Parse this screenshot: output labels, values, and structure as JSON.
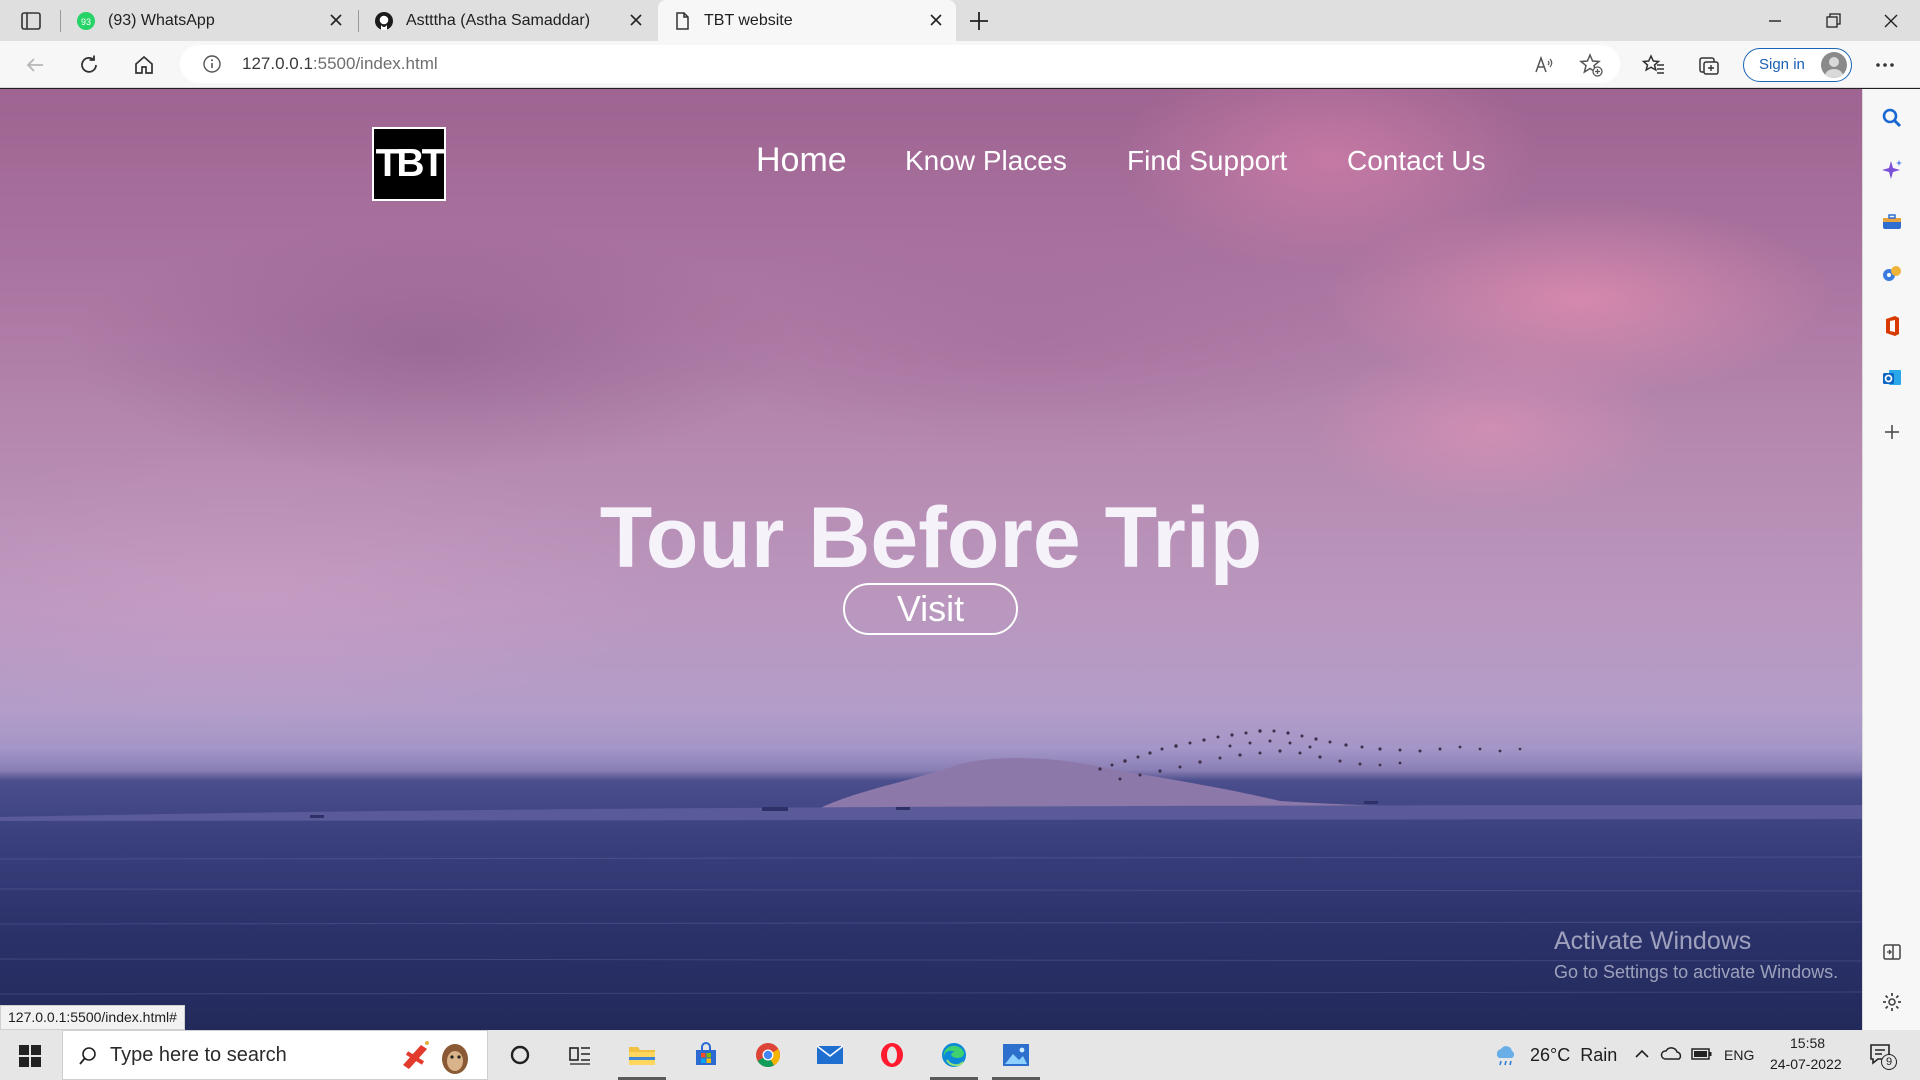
{
  "browser": {
    "tabs": [
      {
        "title": "(93) WhatsApp",
        "badge": "93",
        "icon": "whatsapp-icon",
        "active": false
      },
      {
        "title": "Astttha (Astha Samaddar)",
        "icon": "github-icon",
        "active": false
      },
      {
        "title": "TBT website",
        "icon": "page-icon",
        "active": true
      }
    ],
    "url_host": "127.0.0.1",
    "url_path": ":5500/index.html",
    "sign_in_label": "Sign in",
    "status_url": "127.0.0.1:5500/index.html#"
  },
  "page": {
    "logo_text": "TBT",
    "nav": [
      {
        "label": "Home",
        "active": true
      },
      {
        "label": "Know Places"
      },
      {
        "label": "Find Support"
      },
      {
        "label": "Contact Us"
      }
    ],
    "hero_title": "Tour Before Trip",
    "visit_label": "Visit"
  },
  "watermark": {
    "line1": "Activate Windows",
    "line2": "Go to Settings to activate Windows."
  },
  "taskbar": {
    "search_placeholder": "Type here to search",
    "weather": "26°C  Rain",
    "language": "ENG",
    "time": "15:58",
    "date": "24-07-2022",
    "notification_count": "9"
  },
  "colors": {
    "accent_blue": "#1a64b8",
    "sky_pink": "#b689b0",
    "sea_navy": "#2a3169"
  }
}
